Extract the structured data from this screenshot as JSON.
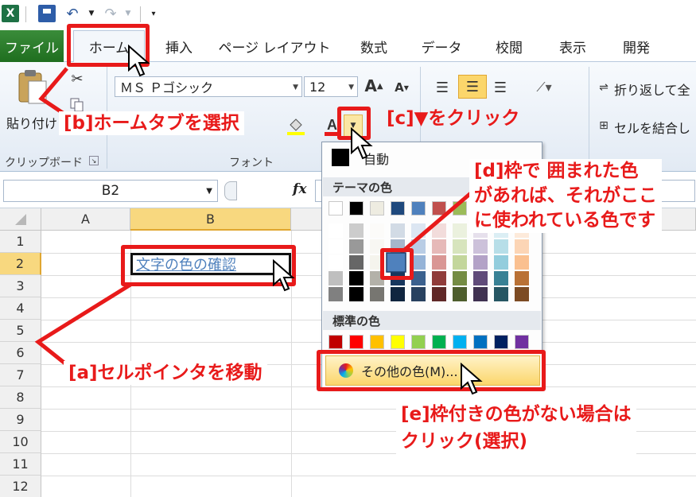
{
  "qat": {
    "logo": "X",
    "undo": "↶",
    "redo": "↷"
  },
  "tabs": {
    "file": "ファイル",
    "home": "ホーム",
    "insert": "挿入",
    "page_layout": "ページ レイアウト",
    "formulas": "数式",
    "data": "データ",
    "review": "校閲",
    "view": "表示",
    "developer": "開発"
  },
  "ribbon": {
    "paste_label": "貼り付け",
    "clipboard_group": "クリップボード",
    "font_group": "フォント",
    "font_name": "ＭＳ Ｐゴシック",
    "font_size": "12",
    "wrap_text": "折り返して全",
    "merge_cells": "セルを結合し"
  },
  "formula_bar": {
    "name_box": "B2",
    "fx": "fx"
  },
  "grid": {
    "columns": [
      "A",
      "B"
    ],
    "rows": [
      "1",
      "2",
      "3",
      "4",
      "5",
      "6",
      "7",
      "8",
      "9",
      "10",
      "11",
      "12"
    ],
    "cell_b2": "文字の色の確認"
  },
  "color_menu": {
    "auto": "自動",
    "theme_header": "テーマの色",
    "standard_header": "標準の色",
    "more_colors": "その他の色(M)..."
  },
  "annotations": {
    "a": "[a]セルポインタを移動",
    "b": "[b]ホームタブを選択",
    "c": "[c]▼をクリック",
    "d_line1": "[d]枠で 囲まれた色",
    "d_line2": "があれば、それがここ",
    "d_line3": "に使われている色です",
    "e_line1": "[e]枠付きの色がない場合は",
    "e_line2": "クリック(選択)"
  },
  "colors": {
    "accent_red": "#e81a1a",
    "theme_row": [
      "#ffffff",
      "#000000",
      "#eeece1",
      "#1f497d",
      "#4f81bd",
      "#c0504d",
      "#9bbb59",
      "#8064a2",
      "#4bacc6",
      "#f79646"
    ],
    "standard_row": [
      "#c00000",
      "#ff0000",
      "#ffc000",
      "#ffff00",
      "#92d050",
      "#00b050",
      "#00b0f0",
      "#0070c0",
      "#002060",
      "#7030a0"
    ]
  }
}
